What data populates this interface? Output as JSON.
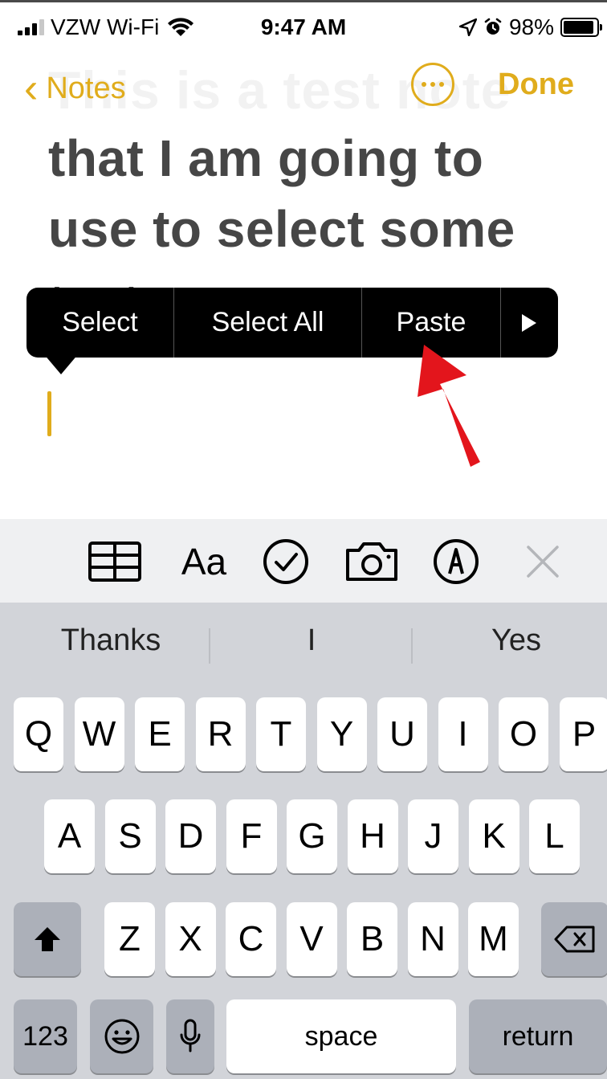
{
  "status_bar": {
    "carrier": "VZW Wi-Fi",
    "time": "9:47 AM",
    "battery": "98%",
    "battery_level": 0.98,
    "signal_bars": 3
  },
  "nav": {
    "back_label": "Notes",
    "done_label": "Done",
    "ghost_title": "This is a test note"
  },
  "note": {
    "lines": [
      "that I am going to",
      "use to select some"
    ],
    "partial_line": "text."
  },
  "edit_menu": {
    "items": [
      "Select",
      "Select All",
      "Paste"
    ],
    "more_icon": "play-triangle-icon"
  },
  "toolbar": {
    "icons": [
      "table-icon",
      "text-format-icon",
      "checklist-icon",
      "camera-icon",
      "markup-pen-icon",
      "close-icon"
    ],
    "format_label": "Aa"
  },
  "keyboard": {
    "suggestions": [
      "Thanks",
      "I",
      "Yes"
    ],
    "row1": [
      "Q",
      "W",
      "E",
      "R",
      "T",
      "Y",
      "U",
      "I",
      "O",
      "P"
    ],
    "row2": [
      "A",
      "S",
      "D",
      "F",
      "G",
      "H",
      "J",
      "K",
      "L"
    ],
    "row3": [
      "Z",
      "X",
      "C",
      "V",
      "B",
      "N",
      "M"
    ],
    "numbers_label": "123",
    "space_label": "space",
    "return_label": "return"
  },
  "colors": {
    "accent": "#e0ac1c",
    "annotation_arrow": "#e3151c",
    "menu_bg": "#000000",
    "keyboard_bg": "#d2d4d9"
  }
}
